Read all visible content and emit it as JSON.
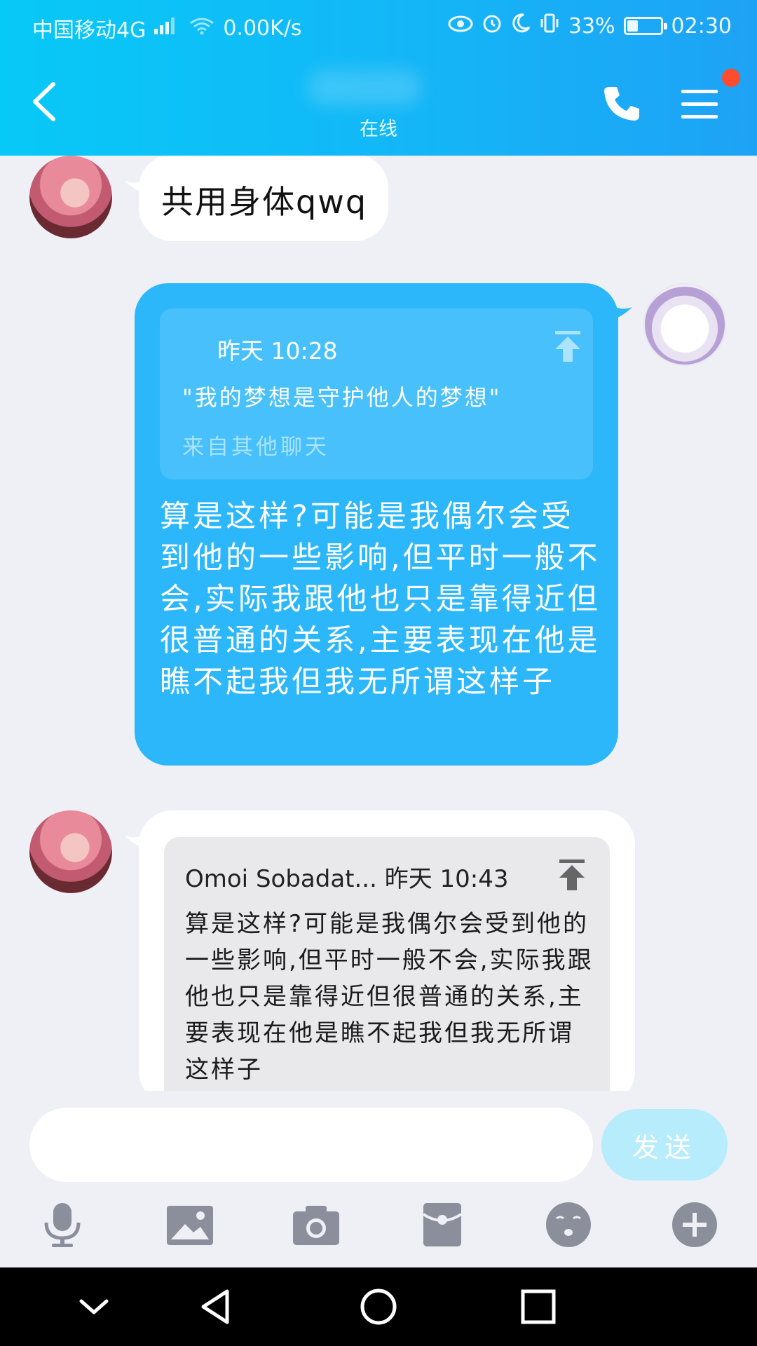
{
  "status_bar": {
    "carrier": "中国移动4G",
    "network_sup": "4G",
    "speed": "0.00K/s",
    "battery_percent": "33%",
    "battery_level": 0.33,
    "time": "02:30"
  },
  "header": {
    "status": "在线",
    "accent_color": "#14b6f7",
    "badge_color": "#ff4b2e"
  },
  "messages": [
    {
      "side": "left",
      "text": "共用身体qwq"
    },
    {
      "side": "right",
      "quote": {
        "time": "昨天 10:28",
        "text": "\"我的梦想是守护他人的梦想\"",
        "source": "来自其他聊天"
      },
      "text": " 算是这样?可能是我偶尔会受到他的一些影响,但平时一般不会,实际我跟他也只是靠得近但很普通的关系,主要表现在他是瞧不起我但我无所谓这样子"
    },
    {
      "side": "left",
      "quote": {
        "header": "Omoi Sobadat... 昨天 10:43",
        "text": " 算是这样?可能是我偶尔会受到他的一些影响,但平时一般不会,实际我跟他也只是靠得近但很普通的关系,主要表现在他是瞧不起我但我无所谓这样子"
      }
    }
  ],
  "input": {
    "placeholder": "",
    "send_label": "发送"
  },
  "toolbar": {
    "icons": [
      "microphone-icon",
      "image-icon",
      "camera-icon",
      "red-packet-icon",
      "emoji-icon",
      "plus-icon"
    ]
  },
  "nav_bar": {
    "icons": [
      "hide-keyboard-icon",
      "back-icon",
      "home-icon",
      "recents-icon"
    ]
  }
}
